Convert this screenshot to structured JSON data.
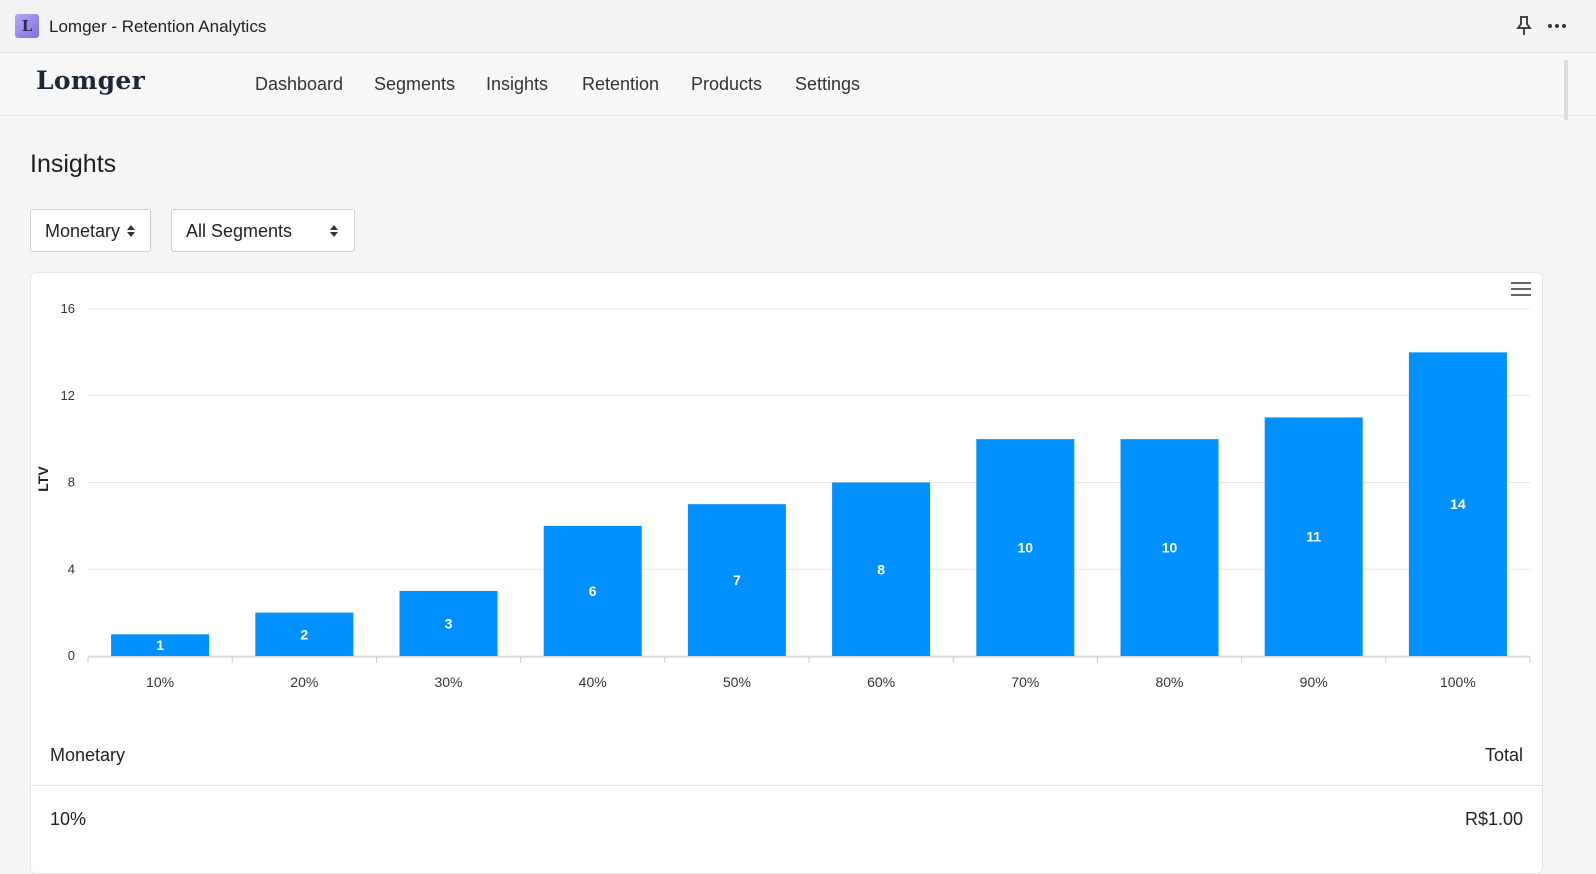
{
  "window": {
    "title": "Lomger - Retention Analytics",
    "icon_letter": "L"
  },
  "nav": {
    "brand": "Lomger",
    "items": [
      "Dashboard",
      "Segments",
      "Insights",
      "Retention",
      "Products",
      "Settings"
    ]
  },
  "page": {
    "title": "Insights"
  },
  "filters": {
    "metric": "Monetary",
    "segment": "All Segments"
  },
  "colors": {
    "bar": "#0090ff",
    "grid": "#e6e6e6"
  },
  "chart_data": {
    "type": "bar",
    "categories": [
      "10%",
      "20%",
      "30%",
      "40%",
      "50%",
      "60%",
      "70%",
      "80%",
      "90%",
      "100%"
    ],
    "values": [
      1,
      2,
      3,
      6,
      7,
      8,
      10,
      10,
      11,
      14
    ],
    "ylabel": "LTV",
    "ylim": [
      0,
      16
    ],
    "yticks": [
      0,
      4,
      8,
      12,
      16
    ],
    "grid": true,
    "data_labels": true
  },
  "table": {
    "headers": {
      "left": "Monetary",
      "right": "Total"
    },
    "rows": [
      {
        "bucket": "10%",
        "total": "R$1.00"
      }
    ]
  }
}
